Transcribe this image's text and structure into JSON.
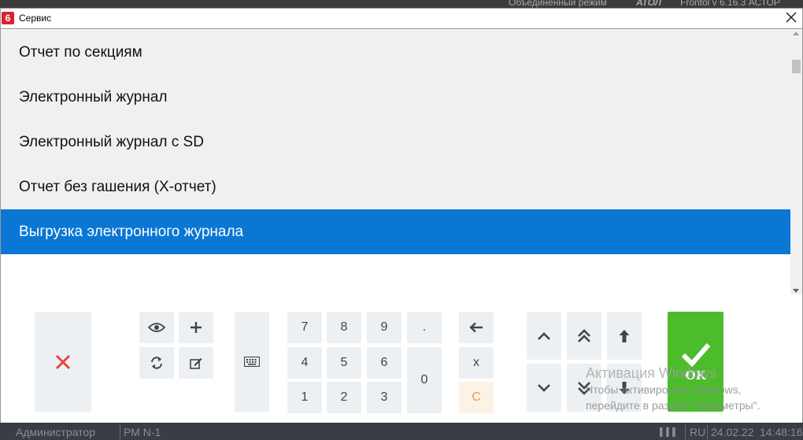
{
  "background_app": {
    "top_text_left": "Объединенный режим",
    "top_text_brand": "АТОЛ",
    "top_text_right": "Frontol v 6.16.3 АСТОР",
    "user": "Администратор",
    "workstation": "РМ N-1",
    "lang": "RU",
    "date": "24.02.22",
    "time": "14:48:16"
  },
  "dialog": {
    "icon_label": "6",
    "title": "Сервис"
  },
  "list": {
    "items": [
      {
        "label": "Отчет по секциям",
        "selected": false
      },
      {
        "label": "Электронный журнал",
        "selected": false
      },
      {
        "label": "Электронный журнал с SD",
        "selected": false
      },
      {
        "label": "Отчет без гашения (Х-отчет)",
        "selected": false
      },
      {
        "label": "Выгрузка электронного журнала",
        "selected": true
      }
    ]
  },
  "keypad": {
    "k7": "7",
    "k8": "8",
    "k9": "9",
    "kdot": ".",
    "k4": "4",
    "k5": "5",
    "k6": "6",
    "k1": "1",
    "k2": "2",
    "k3": "3",
    "k0": "0",
    "mult": "x",
    "clear": "C"
  },
  "ok_label": "OK",
  "watermark": {
    "title": "Активация Windows",
    "line1": "Чтобы активировать Windows,",
    "line2": "перейдите в раздел \"Параметры\"."
  },
  "colors": {
    "selection": "#0a77d5",
    "ok": "#4cbc2d",
    "cancel": "#e64545",
    "clear": "#e8a23a"
  }
}
